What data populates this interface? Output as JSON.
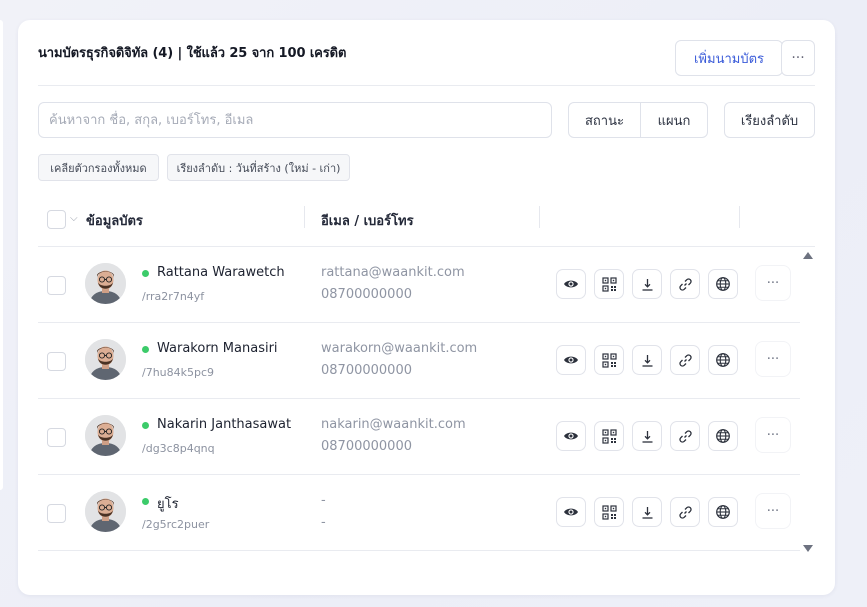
{
  "header": {
    "title": "นามบัตรธุรกิจดิจิทัล (4) | ใช้แล้ว 25 จาก 100 เครดิต",
    "add_button": "เพิ่มนามบัตร",
    "more_icon": "more-horizontal-icon"
  },
  "filters": {
    "search_placeholder": "ค้นหาจาก ชื่อ, สกุล, เบอร์โทร, อีเมล",
    "search_value": "",
    "status_label": "สถานะ",
    "department_label": "แผนก",
    "sort_label": "เรียงลำดับ",
    "chips": [
      "เคลียตัวกรองทั้งหมด",
      "เรียงลำดับ : วันที่สร้าง (ใหม่ - เก่า)"
    ]
  },
  "table": {
    "columns": [
      "ข้อมูลบัตร",
      "อีเมล / เบอร์โทร"
    ],
    "rows": [
      {
        "name": "Rattana Warawetch",
        "slug": "/rra2r7n4yf",
        "email": "rattana@waankit.com",
        "phone": "08700000000"
      },
      {
        "name": "Warakorn Manasiri",
        "slug": "/7hu84k5pc9",
        "email": "warakorn@waankit.com",
        "phone": "08700000000"
      },
      {
        "name": "Nakarin Janthasawat",
        "slug": "/dg3c8p4qnq",
        "email": "nakarin@waankit.com",
        "phone": "08700000000"
      },
      {
        "name": "ยูโร",
        "slug": "/2g5rc2puer",
        "email": "-",
        "phone": "-"
      }
    ],
    "row_actions": [
      "eye-icon",
      "qr-code-icon",
      "download-icon",
      "link-icon",
      "globe-icon"
    ],
    "row_more": "···"
  },
  "colors": {
    "accent": "#3a5bd9",
    "status_active": "#3ccb6a",
    "border": "#dfe2ea"
  }
}
